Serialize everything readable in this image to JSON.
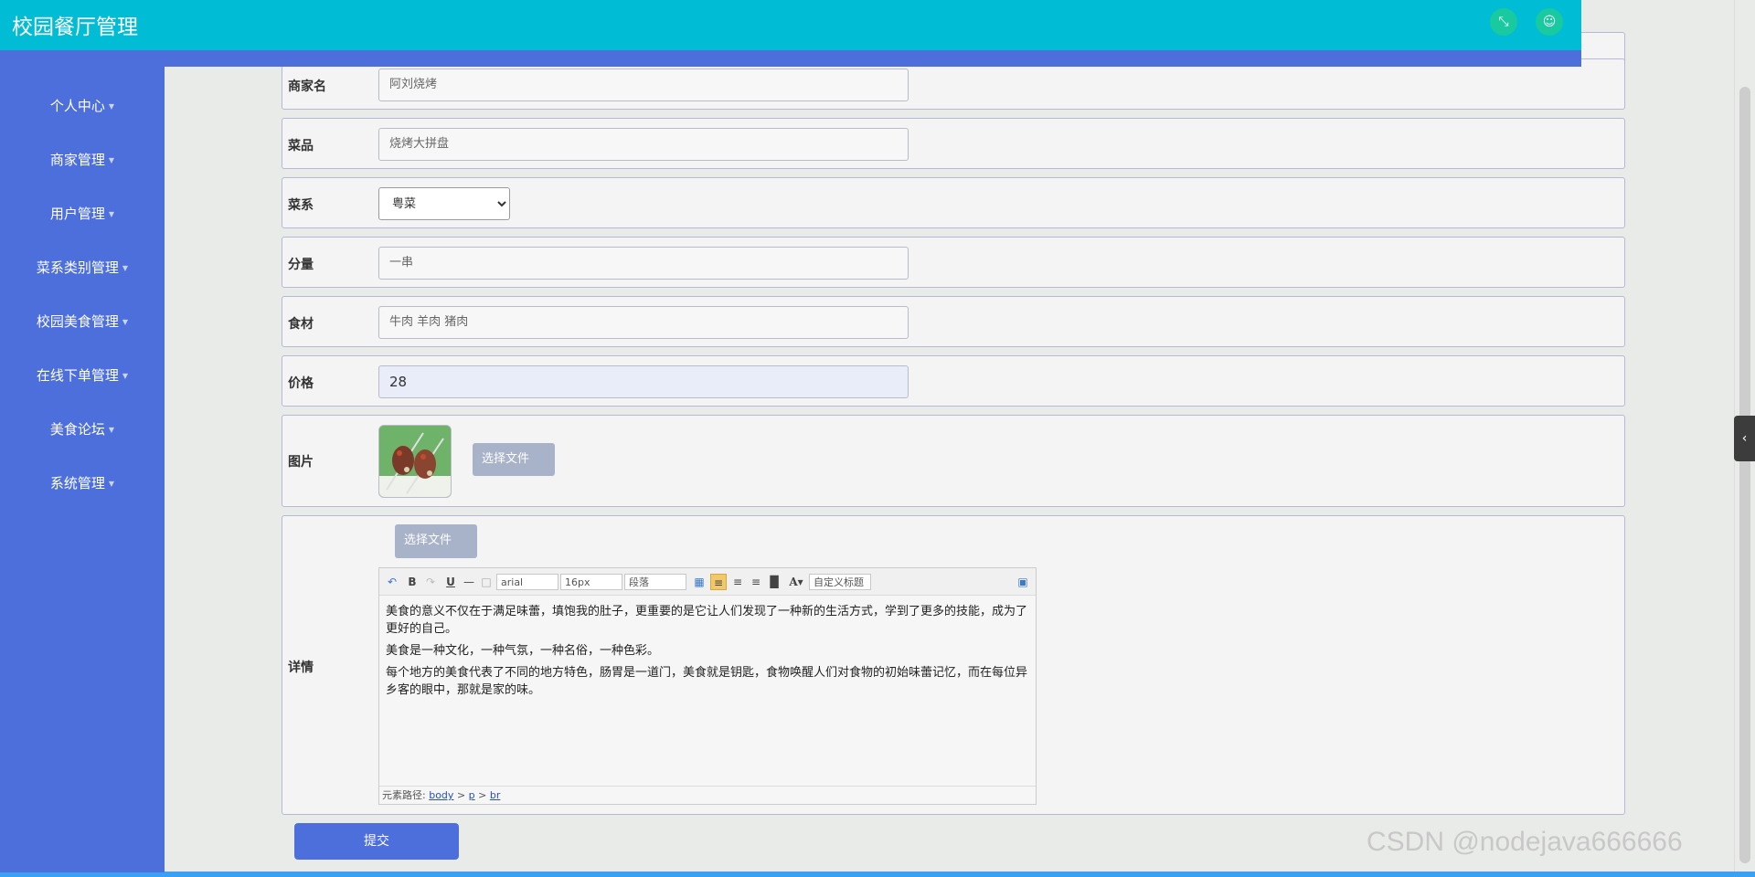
{
  "app": {
    "title": "校园餐厅管理"
  },
  "header": {
    "fullscreen_icon": "expand-icon",
    "user_icon": "user-icon"
  },
  "sidebar": {
    "items": [
      {
        "label": "个人中心"
      },
      {
        "label": "商家管理"
      },
      {
        "label": "用户管理"
      },
      {
        "label": "菜系类别管理"
      },
      {
        "label": "校园美食管理"
      },
      {
        "label": "在线下单管理"
      },
      {
        "label": "美食论坛"
      },
      {
        "label": "系统管理"
      }
    ]
  },
  "form": {
    "merchant": {
      "label": "商家名",
      "value": "阿刘烧烤"
    },
    "dish": {
      "label": "菜品",
      "value": "烧烤大拼盘"
    },
    "cuisine": {
      "label": "菜系",
      "selected": "粤菜"
    },
    "portion": {
      "label": "分量",
      "value": "一串"
    },
    "ingredients": {
      "label": "食材",
      "value": "牛肉 羊肉 猪肉"
    },
    "price": {
      "label": "价格",
      "value": "28"
    },
    "image": {
      "label": "图片",
      "choose_file": "选择文件"
    },
    "details": {
      "label": "详情",
      "choose_file": "选择文件",
      "toolbar": {
        "font": "arial",
        "size": "16px",
        "paragraph": "段落",
        "custom_title": "自定义标题",
        "font_color": "A"
      },
      "paragraphs": [
        "美食的意义不仅在于满足味蕾，填饱我的肚子，更重要的是它让人们发现了一种新的生活方式，学到了更多的技能，成为了更好的自己。",
        "美食是一种文化，一种气氛，一种名俗，一种色彩。",
        "每个地方的美食代表了不同的地方特色，肠胃是一道门，美食就是钥匙，食物唤醒人们对食物的初始味蕾记忆，而在每位异乡客的眼中，那就是家的味。"
      ],
      "status": {
        "prefix": "元素路径:",
        "path1": "body",
        "sep1": ">",
        "path2": "p",
        "sep2": ">",
        "path3": "br"
      }
    },
    "submit_label": "提交"
  },
  "watermark": "CSDN @nodejava666666",
  "colors": {
    "header": "#00bcd4",
    "sidebar": "#4d6fdc",
    "button": "#4d6fdc"
  }
}
